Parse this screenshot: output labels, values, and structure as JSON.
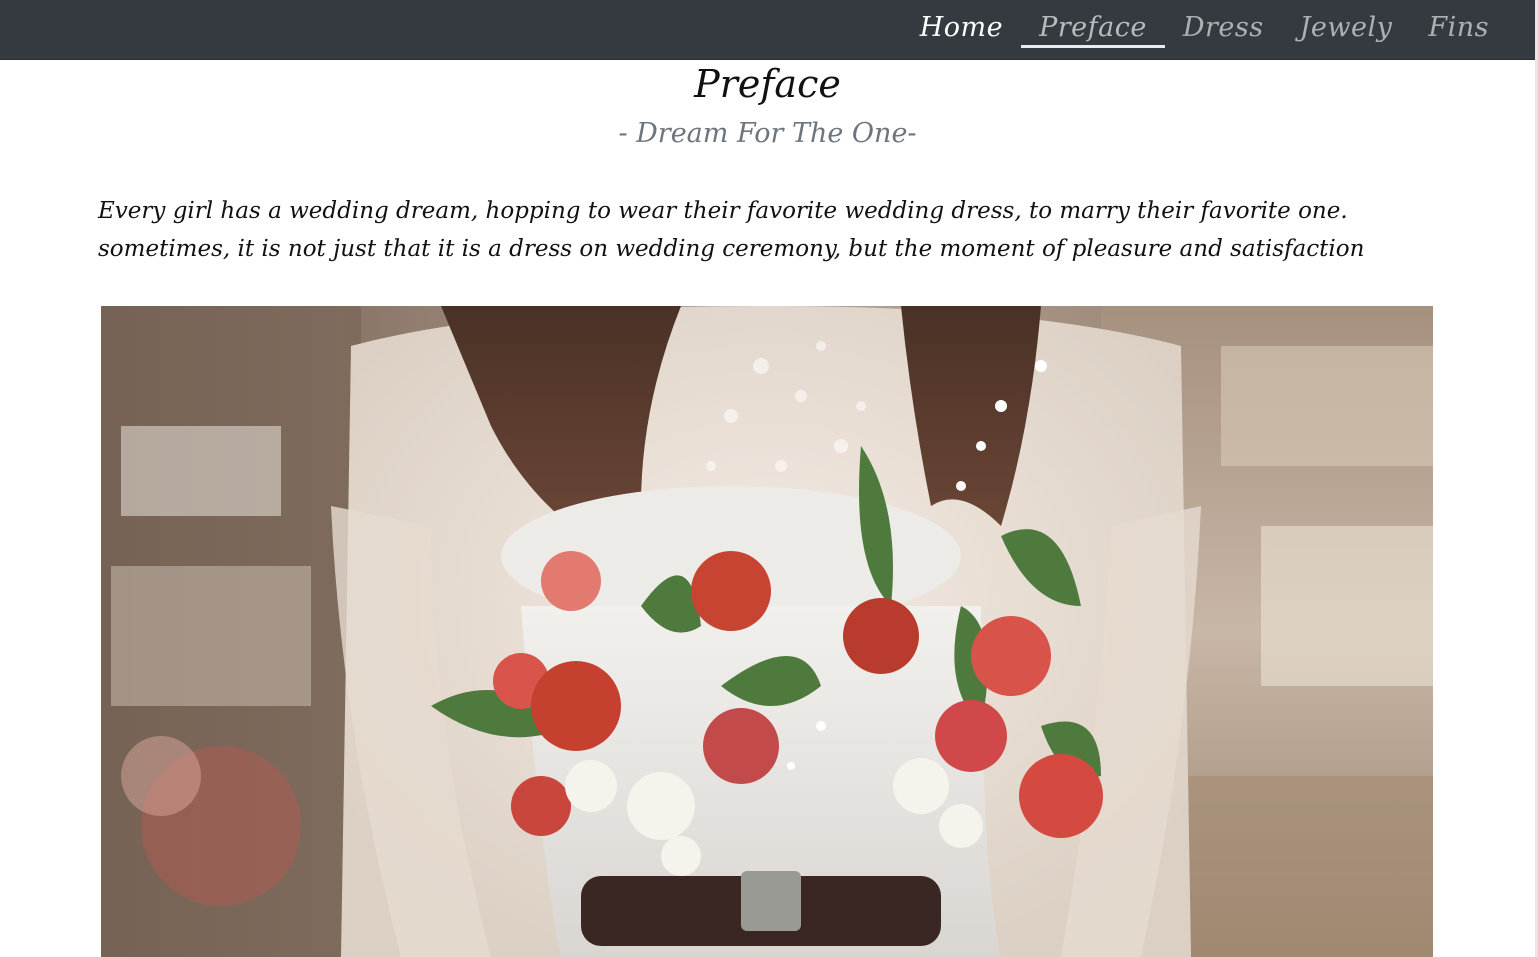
{
  "nav": {
    "items": [
      {
        "label": "Home"
      },
      {
        "label": "Preface"
      },
      {
        "label": "Dress"
      },
      {
        "label": "Jewely"
      },
      {
        "label": "Fins"
      }
    ]
  },
  "section": {
    "title": "Preface",
    "subtitle": "- Dream For The One-",
    "body": "Every girl has a wedding dream, hopping to wear their favorite wedding dress, to marry their favorite one. sometimes, it is not just that it is a dress on wedding ceremony, but the moment of pleasure and satisfaction"
  },
  "colors": {
    "navbar": "#343a40",
    "active_link": "#ffffff",
    "inactive_link": "rgba(255,255,255,0.6)",
    "subtitle": "#6c757d"
  }
}
